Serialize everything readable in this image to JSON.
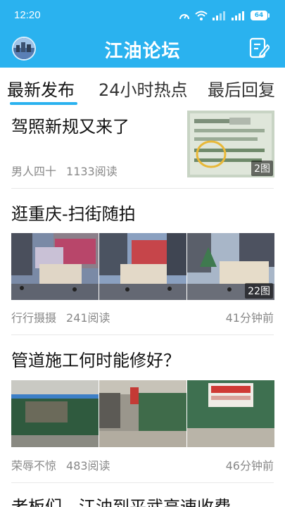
{
  "status_bar": {
    "time": "12:20",
    "battery": "64"
  },
  "header": {
    "title": "江油论坛"
  },
  "tabs": [
    {
      "label": "最新发布",
      "active": true
    },
    {
      "label": "24小时热点",
      "active": false
    },
    {
      "label": "最后回复",
      "active": false
    }
  ],
  "posts": [
    {
      "title": "驾照新规又来了",
      "author": "男人四十",
      "reads": "1133阅读",
      "time": "",
      "image_count": "2图"
    },
    {
      "title": "逛重庆-扫街随拍",
      "author": "行行摄摄",
      "reads": "241阅读",
      "time": "41分钟前",
      "image_count": "22图"
    },
    {
      "title": "管道施工何时能修好？",
      "author": "荣辱不惊",
      "reads": "483阅读",
      "time": "46分钟前",
      "image_count": ""
    },
    {
      "title": "老板们，江油到平武高速收费"
    }
  ],
  "colors": {
    "accent": "#2ab2ef",
    "text": "#111111",
    "meta": "#888888"
  }
}
